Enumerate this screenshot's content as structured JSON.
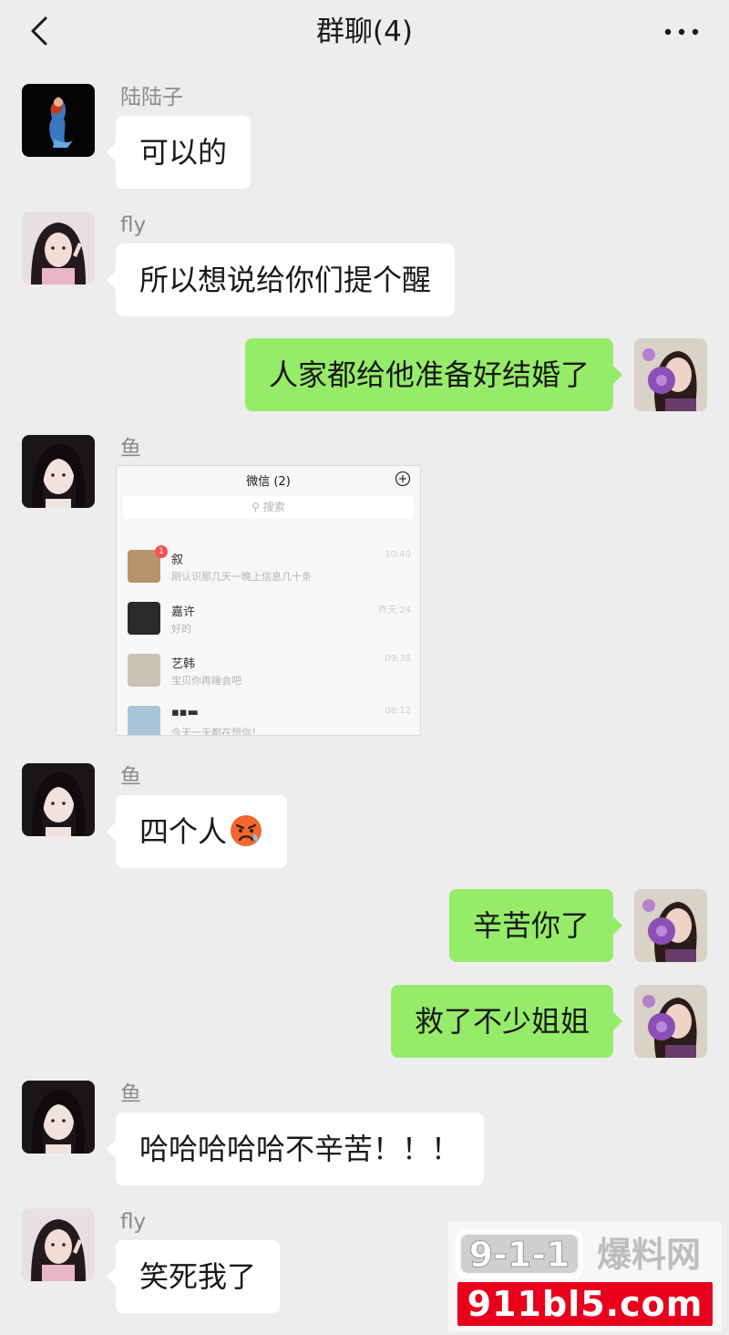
{
  "header": {
    "title": "群聊(4)"
  },
  "messages": [
    {
      "sender": "陆陆子",
      "text": "可以的"
    },
    {
      "sender": "fly",
      "text": "所以想说给你们提个醒"
    },
    {
      "text": "人家都给他准备好结婚了"
    },
    {
      "sender": "鱼",
      "screenshot": {
        "title": "微信 (2)",
        "search_placeholder": "搜索",
        "chats": [
          {
            "name": "叙",
            "preview": "刚认识那几天一晚上信息几十条",
            "time": "10:49",
            "badge": "1"
          },
          {
            "name": "嘉许",
            "preview": "好的",
            "time": "昨天 24"
          },
          {
            "name": "艺韩",
            "preview": "宝贝你再睡会吧",
            "time": "09:38"
          },
          {
            "name": "▪︎▪︎▬",
            "preview": "今天一天都在想你！",
            "time": "08:12"
          }
        ]
      }
    },
    {
      "sender": "鱼",
      "text": "四个人"
    },
    {
      "text": "辛苦你了"
    },
    {
      "text": "救了不少姐姐"
    },
    {
      "sender": "鱼",
      "text": "哈哈哈哈哈不辛苦！！！"
    },
    {
      "sender": "fly",
      "text": "笑死我了"
    }
  ],
  "icons": {
    "back": "chevron-left-icon",
    "more": "more-dots-icon",
    "emoji": "angry-crying-emoji"
  },
  "watermark": {
    "brand": "9-1-1爆料网",
    "url": "911bl5.com"
  },
  "colors": {
    "background": "#ededed",
    "incoming_bubble": "#ffffff",
    "outgoing_bubble": "#95ec69",
    "badge": "#fa5151",
    "watermark_red": "#e8001c"
  }
}
